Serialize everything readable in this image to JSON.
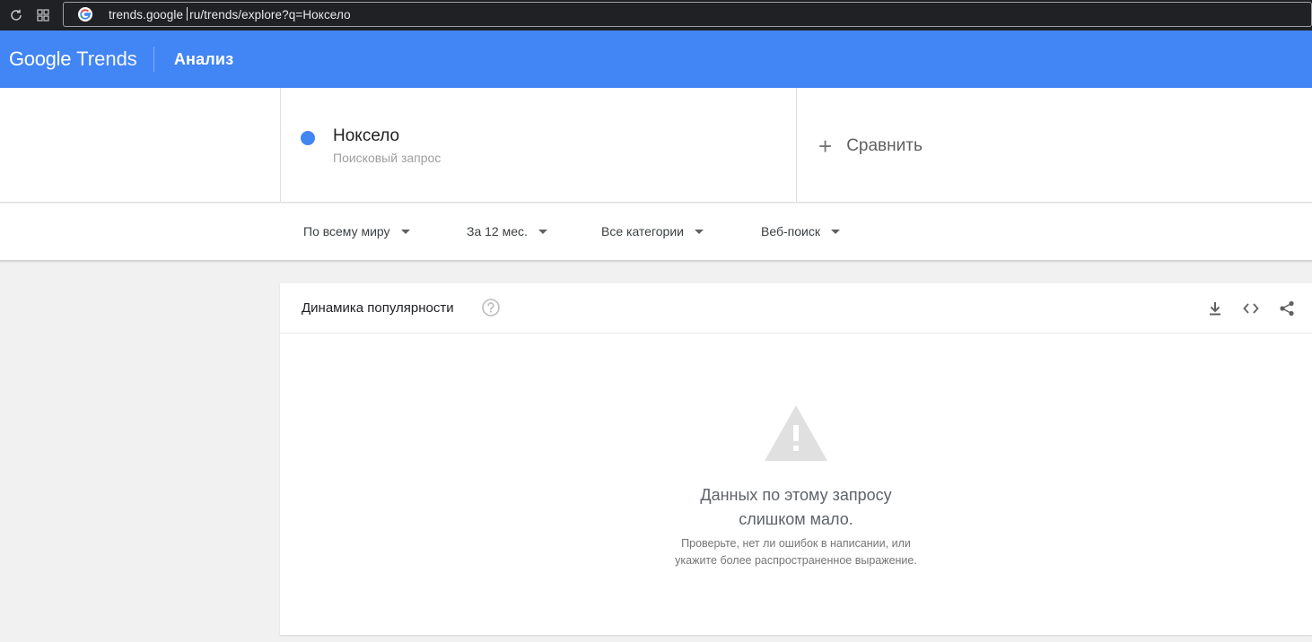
{
  "browser": {
    "url_host": "trends.google",
    "url_rest": "ru/trends/explore?q=Ноксело",
    "reload_icon": "reload-icon",
    "apps_icon": "apps-grid-icon",
    "site_icon": "google-g-icon"
  },
  "header": {
    "logo_google": "Google",
    "logo_trends": "Trends",
    "title": "Анализ",
    "brand_color": "#4285f4"
  },
  "term": {
    "name": "Ноксело",
    "subtitle": "Поисковый запрос",
    "dot_color": "#4285f4"
  },
  "compare": {
    "label": "Сравнить"
  },
  "filters": [
    {
      "label": "По всему миру"
    },
    {
      "label": "За 12 мес."
    },
    {
      "label": "Все категории"
    },
    {
      "label": "Веб-поиск"
    }
  ],
  "card": {
    "title": "Динамика популярности",
    "tools": [
      "download-icon",
      "embed-code-icon",
      "share-icon"
    ],
    "message_line1": "Данных по этому запросу",
    "message_line2": "слишком мало.",
    "hint_line1": "Проверьте, нет ли ошибок в написании, или",
    "hint_line2": "укажите более распространенное выражение."
  }
}
